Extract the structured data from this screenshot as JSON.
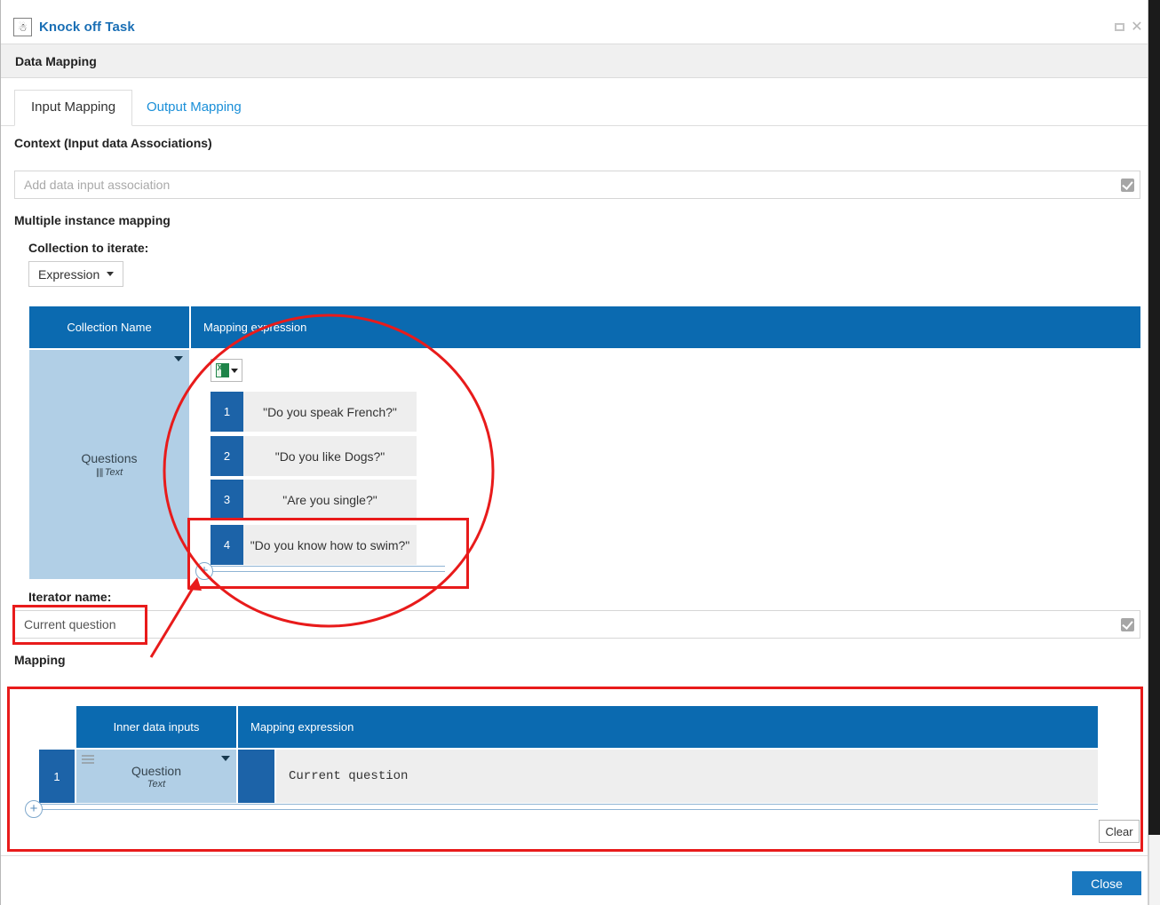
{
  "window": {
    "title": "Knock off Task",
    "task_icon": "user-task-icon",
    "restore_label": "restore-icon",
    "close_label": "close-icon"
  },
  "section": {
    "title": "Data Mapping"
  },
  "tabs": [
    {
      "label": "Input Mapping",
      "active": true
    },
    {
      "label": "Output Mapping",
      "active": false
    }
  ],
  "context": {
    "label": "Context (Input data Associations)",
    "placeholder": "Add data input association",
    "value": "",
    "confirm_icon": "checkbox-confirm-icon"
  },
  "multiple_instance": {
    "label": "Multiple instance mapping",
    "collection_to_iterate_label": "Collection to iterate:",
    "expression_dropdown": "Expression"
  },
  "collection_grid": {
    "headers": [
      "Collection Name",
      "Mapping expression"
    ],
    "collection_name": "Questions",
    "collection_type": "Text",
    "collection_type_glyph": "list-type-icon",
    "expression_type_icon": "excel-expression-icon",
    "rows": [
      {
        "index": "1",
        "value": "\"Do you speak French?\""
      },
      {
        "index": "2",
        "value": "\"Do you like Dogs?\""
      },
      {
        "index": "3",
        "value": "\"Are you single?\""
      },
      {
        "index": "4",
        "value": "\"Do you know how to swim?\""
      }
    ],
    "add_row_label": "+"
  },
  "iterator": {
    "label": "Iterator name:",
    "value": "Current question",
    "confirm_icon": "checkbox-confirm-icon"
  },
  "mapping": {
    "label": "Mapping",
    "headers": [
      "Inner data inputs",
      "Mapping expression"
    ],
    "rows": [
      {
        "index": "1",
        "name": "Question",
        "type": "Text",
        "expression": "Current question"
      }
    ],
    "add_row_label": "+",
    "clear_label": "Clear"
  },
  "footer": {
    "close_label": "Close"
  },
  "colors": {
    "accent_blue": "#0b6ab0",
    "row_blue": "#1c63a8",
    "cell_blue": "#b1cfe6",
    "link_blue": "#1a8fd8",
    "annotation_red": "#e81b1b",
    "progress_green": "#56a25a"
  }
}
